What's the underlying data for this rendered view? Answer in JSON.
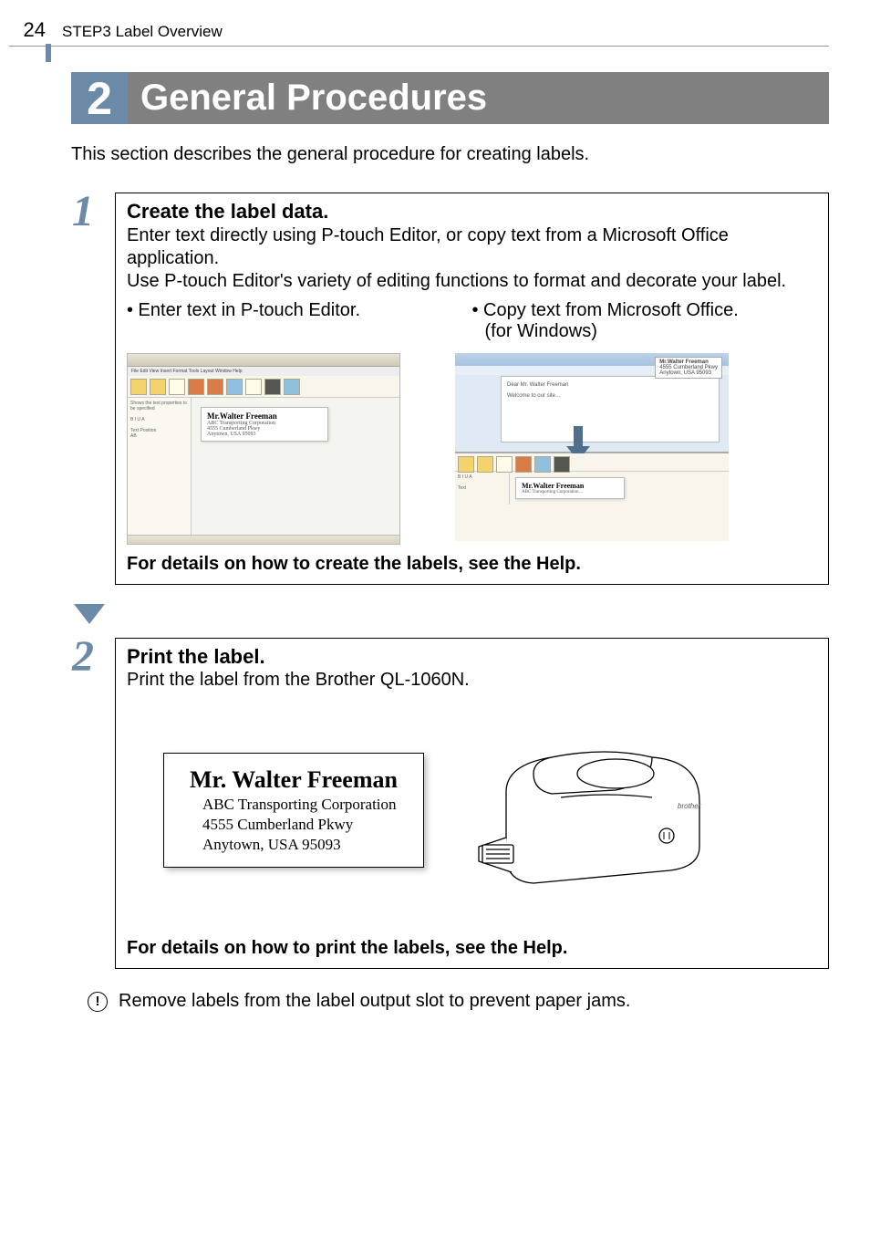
{
  "page_number": "24",
  "breadcrumb": "STEP3 Label Overview",
  "chapter": {
    "number": "2",
    "title": "General Procedures"
  },
  "intro": "This section describes the general procedure for creating labels.",
  "step1": {
    "num": "1",
    "title": "Create the label data.",
    "body_line1": "Enter text directly using P-touch Editor, or copy text from a Microsoft Office application.",
    "body_line2": "Use P-touch Editor's variety of editing functions to format and decorate your label.",
    "bullet_left": "• Enter text in P-touch Editor.",
    "bullet_right_l1": "• Copy text from Microsoft Office.",
    "bullet_right_l2": "(for Windows)",
    "details": "For details on how to create the labels, see the Help."
  },
  "sample_label": {
    "name": "Mr.Walter Freeman",
    "line1": "ABC Transporting Corporation",
    "line2": "4555 Cumberland Pkwy",
    "line3": "Anytown, USA 95093"
  },
  "step2": {
    "num": "2",
    "title": "Print the label.",
    "body": "Print the label from the Brother QL-1060N.",
    "details": "For details on how to print the labels, see the Help."
  },
  "print_label": {
    "name": "Mr. Walter Freeman",
    "line1": "ABC Transporting Corporation",
    "line2": "4555 Cumberland Pkwy",
    "line3": "Anytown, USA 95093"
  },
  "note": "Remove labels from the label output slot to prevent paper jams.",
  "note_icon": "!"
}
